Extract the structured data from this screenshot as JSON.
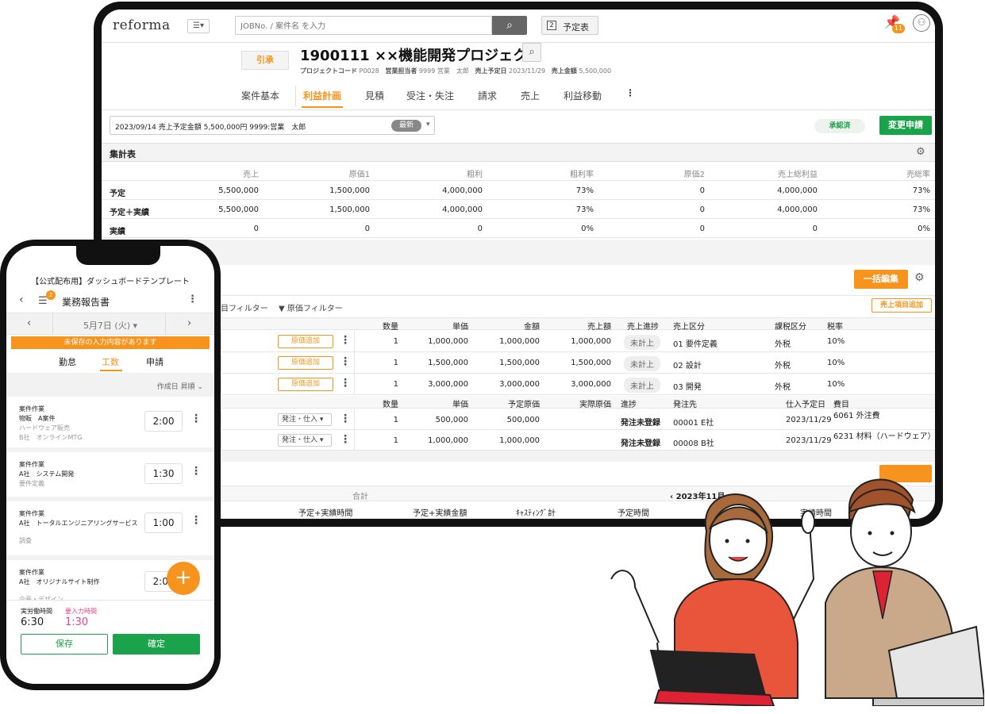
{
  "app": {
    "logo": "reforma",
    "search_placeholder": "JOBNo. / 案件名 を入力",
    "calendar_label": "予定表",
    "calendar_num": "2",
    "notif_count": "11"
  },
  "project": {
    "status_btn": "引承",
    "title": "1900111 ××機能開発プロジェクト",
    "meta": [
      {
        "k": "プロジェクトコード",
        "v": "P0028"
      },
      {
        "k": "営業担当者",
        "v": "9999 営業　太郎"
      },
      {
        "k": "売上予定日",
        "v": "2023/11/29"
      },
      {
        "k": "売上金額",
        "v": "5,500,000"
      }
    ]
  },
  "tabs": [
    "案件基本",
    "利益計画",
    "見積",
    "受注・失注",
    "請求",
    "売上",
    "利益移動"
  ],
  "version": {
    "text": "2023/09/14 売上予定金額 5,500,000円 9999:営業　太郎",
    "badge": "最新",
    "approved": "承認済",
    "change_btn": "変更申請"
  },
  "summary": {
    "title": "集計表",
    "headers": [
      "売上",
      "原価1",
      "粗利",
      "粗利率",
      "原価2",
      "売上総利益",
      "売総率"
    ],
    "rows": [
      {
        "label": "予定",
        "vals": [
          "5,500,000",
          "1,500,000",
          "4,000,000",
          "73%",
          "0",
          "4,000,000",
          "73%"
        ]
      },
      {
        "label": "予定＋実績",
        "vals": [
          "5,500,000",
          "1,500,000",
          "4,000,000",
          "73%",
          "0",
          "4,000,000",
          "73%"
        ]
      },
      {
        "label": "実績",
        "vals": [
          "0",
          "0",
          "0",
          "0%",
          "0",
          "0",
          "0%"
        ]
      }
    ]
  },
  "detail": {
    "bulk_edit": "一括編集",
    "filter1": "項目フィルター",
    "filter2": "原価フィルター",
    "add_sales": "売上項目追加",
    "sales_headers": [
      "数量",
      "単価",
      "金額",
      "売上額",
      "売上進捗",
      "売上区分",
      "課税区分",
      "税率"
    ],
    "sales_rows": [
      {
        "btn": "原価追加",
        "qty": "1",
        "price": "1,000,000",
        "amount": "1,000,000",
        "sales": "1,000,000",
        "progress": "未計上",
        "cat": "01 要件定義",
        "tax": "外税",
        "rate": "10%"
      },
      {
        "btn": "原価追加",
        "qty": "1",
        "price": "1,500,000",
        "amount": "1,500,000",
        "sales": "1,500,000",
        "progress": "未計上",
        "cat": "02 設計",
        "tax": "外税",
        "rate": "10%"
      },
      {
        "btn": "原価追加",
        "qty": "1",
        "price": "3,000,000",
        "amount": "3,000,000",
        "sales": "3,000,000",
        "progress": "未計上",
        "cat": "03 開発",
        "tax": "外税",
        "rate": "10%"
      }
    ],
    "cost_headers": [
      "数量",
      "単価",
      "予定原価",
      "実際原価",
      "進捗",
      "発注先",
      "仕入予定日",
      "費目"
    ],
    "cost_rows": [
      {
        "sel": "発注・仕入",
        "qty": "1",
        "price": "500,000",
        "plan": "500,000",
        "status": "発注未登録",
        "vendor": "00001 E社",
        "date": "2023/11/29",
        "item": "6061 外注費"
      },
      {
        "sel": "発注・仕入",
        "qty": "1",
        "price": "1,000,000",
        "plan": "1,000,000",
        "status": "発注未登録",
        "vendor": "00008 B社",
        "date": "2023/11/29",
        "item": "6231 材料（ハードウェア）"
      }
    ]
  },
  "labor": {
    "total": "合計",
    "month": "2023年11月",
    "cols": [
      "予定+実績時間",
      "予定+実績金額",
      "ｷｬｽﾃｨﾝｸﾞ計",
      "予定時間",
      "実績時間"
    ]
  },
  "phone": {
    "dashboard": "【公式配布用】ダッシュボードテンプレート",
    "menu_badge": "2",
    "title": "業務報告書",
    "date": "5月7日 (火)",
    "warning": "未保存の入力内容があります",
    "tabs": [
      "勤怠",
      "工数",
      "申請"
    ],
    "sort": "作成日 昇順",
    "cards": [
      {
        "type": "案件作業",
        "l1": "物販　A案件",
        "l2": "ハードウェア販売",
        "l3": "B社　オンラインMTG",
        "time": "2:00"
      },
      {
        "type": "案件作業",
        "l1": "A社　システム開発",
        "l2": "要件定義",
        "l3": "",
        "time": "1:30"
      },
      {
        "type": "案件作業",
        "l1": "A社　トータルエンジニアリングサービス",
        "l2": "調査",
        "l3": "",
        "time": "1:00"
      },
      {
        "type": "案件作業",
        "l1": "A社　オリジナルサイト制作",
        "l2": "企画・デザイン",
        "l3": "",
        "time": "2:00"
      }
    ],
    "actual_label": "実労働時間",
    "actual": "6:30",
    "need_label": "要入力時間",
    "need": "1:30",
    "save": "保存",
    "confirm": "確定"
  },
  "colors": {
    "accent": "#f7941d",
    "green": "#1aa34a",
    "pink": "#e6448a"
  }
}
